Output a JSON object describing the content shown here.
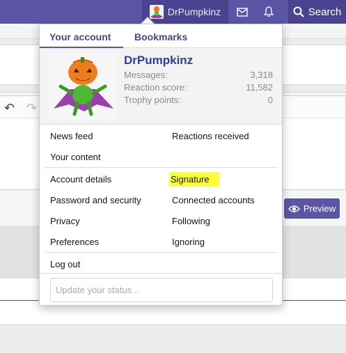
{
  "nav": {
    "username": "DrPumpkinz",
    "search_label": "Search"
  },
  "editor": {
    "preview_label": "Preview"
  },
  "menu": {
    "tabs": [
      {
        "label": "Your account",
        "active": true
      },
      {
        "label": "Bookmarks",
        "active": false
      }
    ],
    "profile": {
      "name": "DrPumpkinz",
      "stats": [
        {
          "label": "Messages:",
          "value": "3,318"
        },
        {
          "label": "Reaction score:",
          "value": "11,582"
        },
        {
          "label": "Trophy points:",
          "value": "0"
        }
      ]
    },
    "links": {
      "news_feed": "News feed",
      "reactions_received": "Reactions received",
      "your_content": "Your content",
      "account_details": "Account details",
      "signature": "Signature",
      "password_security": "Password and security",
      "connected_accounts": "Connected accounts",
      "privacy": "Privacy",
      "following": "Following",
      "preferences": "Preferences",
      "ignoring": "Ignoring",
      "log_out": "Log out"
    },
    "status_placeholder": "Update your status..."
  },
  "colors": {
    "brand": "#5c55a6",
    "username_link": "#2c3f9e",
    "highlight": "#ffff33"
  }
}
